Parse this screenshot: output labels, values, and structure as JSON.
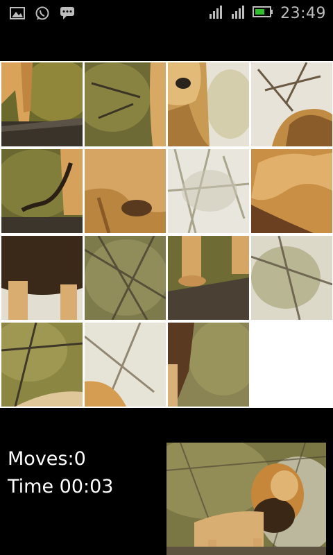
{
  "status_bar": {
    "time": "23:49",
    "left_icons": [
      "gallery-icon",
      "whatsapp-icon",
      "message-icon"
    ],
    "right_icons": [
      "signal-icon",
      "signal-icon",
      "battery-icon"
    ]
  },
  "game": {
    "moves_label": "Moves:0",
    "time_label": "Time 00:03",
    "grid": {
      "rows": 4,
      "cols": 4,
      "empty_tile": 16
    }
  },
  "colors": {
    "background": "#000000",
    "board_gap": "#ffffff",
    "text": "#ffffff",
    "battery": "#2fbf2f"
  }
}
